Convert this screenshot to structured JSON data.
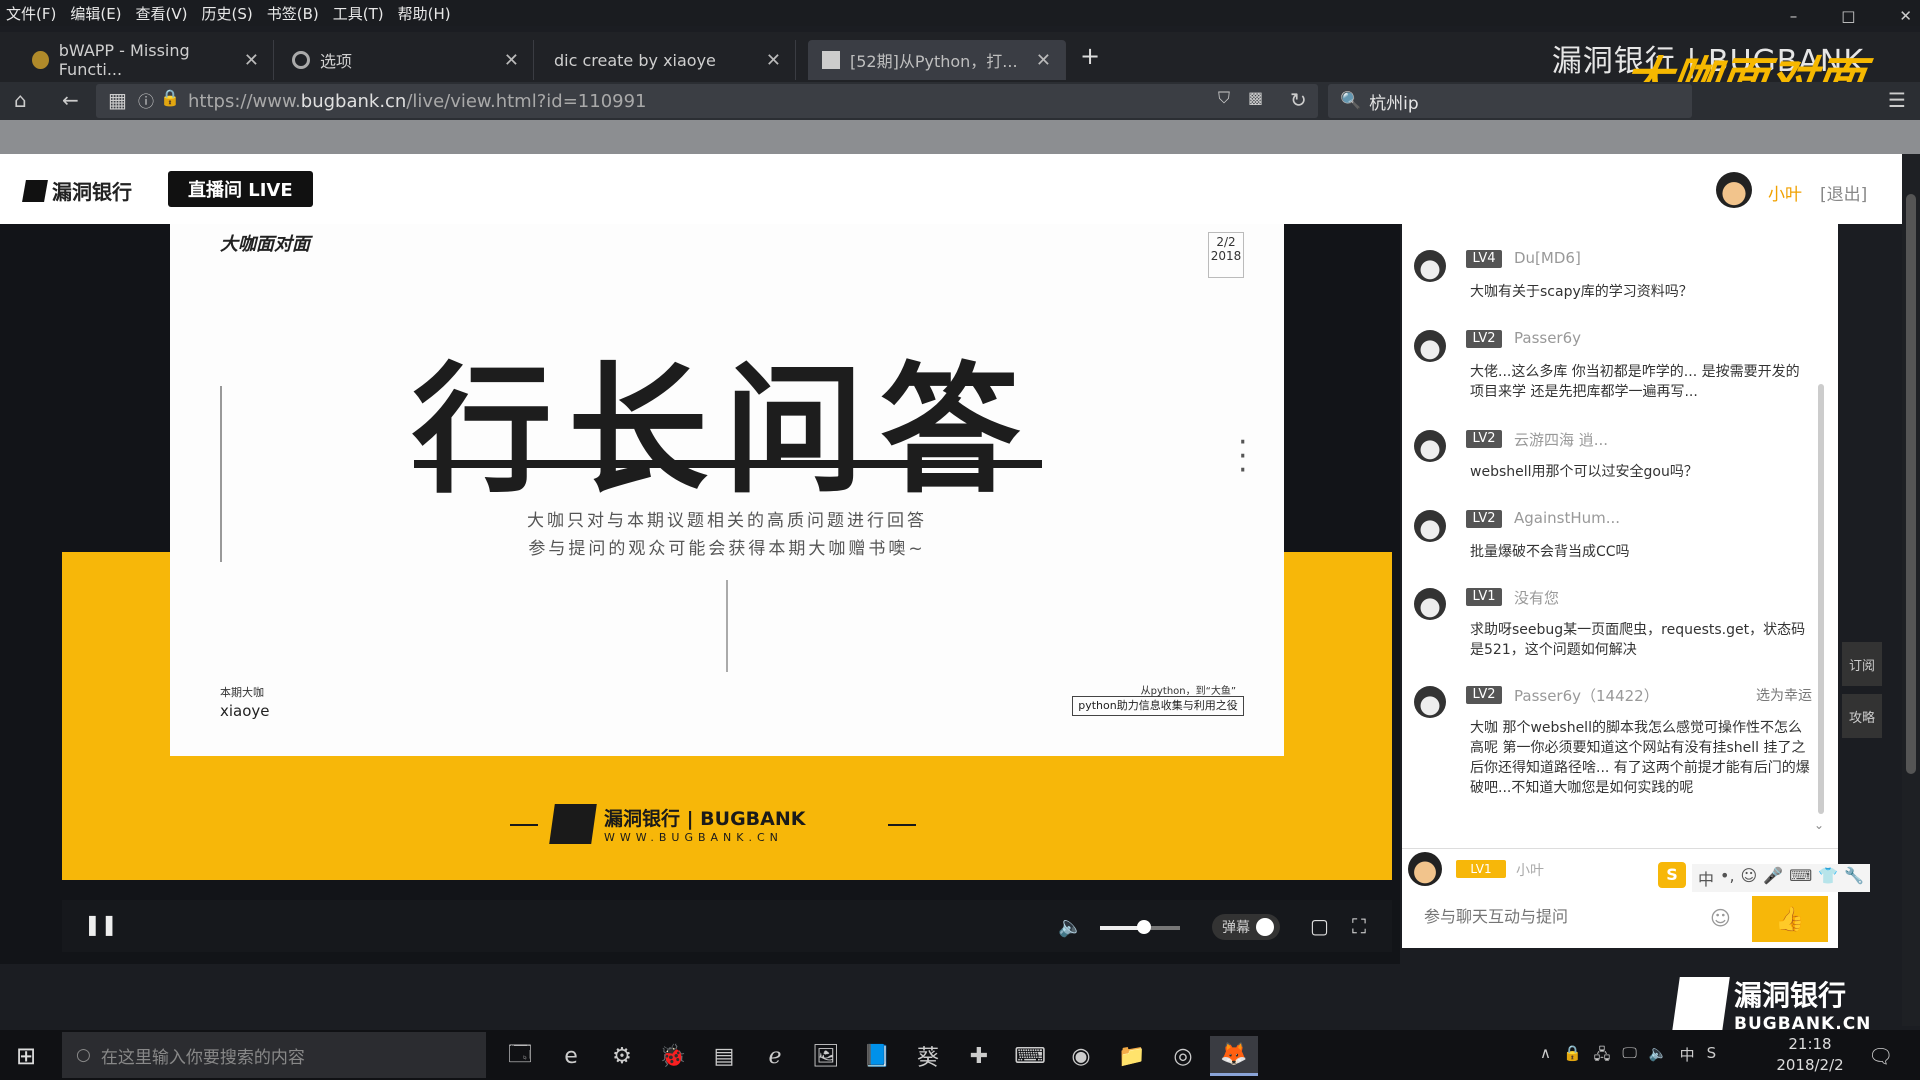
{
  "menubar": {
    "items": [
      "文件(F)",
      "编辑(E)",
      "查看(V)",
      "历史(S)",
      "书签(B)",
      "工具(T)",
      "帮助(H)"
    ]
  },
  "window_controls": {
    "minimize": "–",
    "maximize": "□",
    "close": "✕"
  },
  "tabs": [
    {
      "label": "bWAPP - Missing Functi...",
      "close": "✕"
    },
    {
      "label": "选项",
      "close": "✕"
    },
    {
      "label": "dic create by xiaoye",
      "close": "✕"
    },
    {
      "label": "[52期]从Python，打...",
      "close": "✕"
    }
  ],
  "new_tab": "+",
  "browser_brand": {
    "text": "漏洞银行 | BUGBANK",
    "overlay": "大咖面对面"
  },
  "navbar": {
    "url_prefix": "https://www.",
    "url_domain": "bugbank.cn",
    "url_path": "/live/view.html?id=110991",
    "search_value": "杭州ip"
  },
  "site_header": {
    "logo": "漏洞银行",
    "live_badge": "直播间 LIVE",
    "user_name": "小叶",
    "logout": "[退出]"
  },
  "slide": {
    "tag": "大咖面对面",
    "page_top": "2/2",
    "page_year": "2018",
    "title": "行长问答",
    "line1": "大咖只对与本期议题相关的高质问题进行回答",
    "line2": "参与提问的观众可能会获得本期大咖赠书噢~",
    "host_label": "本期大咖",
    "host_name": "xiaoye",
    "topic_small": "从python，到“大鱼”",
    "topic_box": "python助力信息收集与利用之役",
    "band_logo_cn": "漏洞银行 | BUGBANK",
    "band_logo_url": "WWW.BUGBANK.CN"
  },
  "controls": {
    "pause": "❚❚",
    "volume_icon": "🔈",
    "volume_level": 0.55,
    "danmaku_label": "弹幕",
    "pip": "▢",
    "fullscreen": "⛶"
  },
  "chat": {
    "messages": [
      {
        "level": "LV4",
        "name": "Du[MD6]",
        "text": "大咖有关于scapy库的学习资料吗？",
        "tag": ""
      },
      {
        "level": "LV2",
        "name": "Passer6y",
        "text": "大佬...这么多库 你当初都是咋学的... 是按需要开发的项目来学 还是先把库都学一遍再写...",
        "tag": ""
      },
      {
        "level": "LV2",
        "name": "云游四海 逍...",
        "text": "webshell用那个可以过安全gou吗？",
        "tag": ""
      },
      {
        "level": "LV2",
        "name": "AgainstHum...",
        "text": "批量爆破不会背当成CC吗",
        "tag": ""
      },
      {
        "level": "LV1",
        "name": "没有您",
        "text": "求助呀seebug某一页面爬虫，requests.get，状态码是521，这个问题如何解决",
        "tag": ""
      },
      {
        "level": "LV2",
        "name": "Passer6y（14422）",
        "text": "大咖 那个webshell的脚本我怎么感觉可操作性不怎么高呢 第一你必须要知道这个网站有没有挂shell 挂了之后你还得知道路径啥... 有了这两个前提才能有后门的爆破吧...不知道大咖您是如何实践的呢",
        "tag": "选为幸运"
      }
    ],
    "me_level": "LV1",
    "me_name": "小叶",
    "input_placeholder": "参与聊天互动与提问",
    "emoji": "☺",
    "like": "👍",
    "ime": [
      "中",
      "•,",
      "☺",
      "🎤",
      "⌨",
      "👕",
      "🔧"
    ],
    "ime_logo": "S"
  },
  "side_tabs": [
    "订阅",
    "攻略"
  ],
  "watermark": {
    "cn": "漏洞银行",
    "en": "BUGBANK.CN"
  },
  "taskbar": {
    "search_placeholder": "在这里输入你要搜索的内容",
    "apps": [
      "🗔",
      "e",
      "⚙",
      "🐞",
      "▤",
      "ℯ",
      "🖼",
      "📘",
      "葵",
      "✚",
      "⌨",
      "◉",
      "📁",
      "◎",
      "🦊"
    ],
    "tray": [
      "∧",
      "🔒",
      "🖧",
      "🖵",
      "🔈",
      "中",
      "S"
    ],
    "time": "21:18",
    "date": "2018/2/2"
  },
  "colors": {
    "brand_yellow": "#f7b709",
    "dark": "#121418"
  }
}
